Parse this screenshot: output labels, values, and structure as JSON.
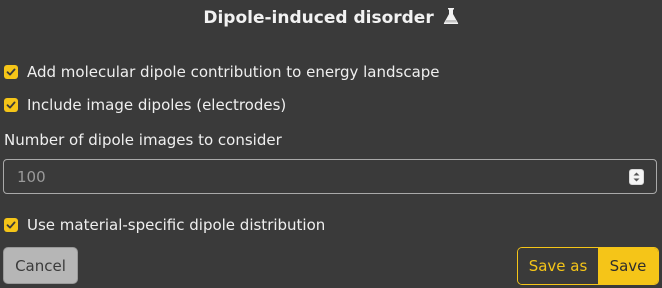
{
  "dialog": {
    "title": "Dipole-induced disorder",
    "title_icon": "flask-icon",
    "accent_color": "#f5c518",
    "background_color": "#3a3a3a"
  },
  "options": {
    "molecular_dipole": {
      "label": "Add molecular dipole contribution to energy landscape",
      "checked": true
    },
    "image_dipoles": {
      "label": "Include image dipoles (electrodes)",
      "checked": true
    },
    "material_specific": {
      "label": "Use material-specific dipole distribution",
      "checked": true
    }
  },
  "dipole_images": {
    "label": "Number of dipole images to consider",
    "placeholder": "100"
  },
  "buttons": {
    "cancel": "Cancel",
    "save_as": "Save as",
    "save": "Save"
  }
}
